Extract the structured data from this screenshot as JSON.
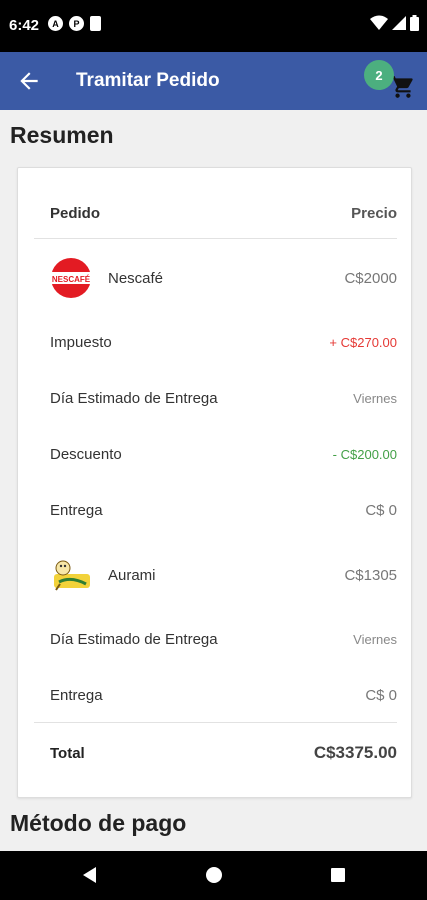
{
  "status_bar": {
    "time": "6:42",
    "icons": [
      "notification-a-icon",
      "notification-p-icon",
      "sd-card-icon",
      "wifi-icon",
      "signal-icon",
      "battery-icon"
    ]
  },
  "app_bar": {
    "title": "Tramitar Pedido",
    "cart_count": "2",
    "color": "#3b5aa5",
    "badge_color": "#4caf7f"
  },
  "summary": {
    "title": "Resumen",
    "header": {
      "order_label": "Pedido",
      "price_label": "Precio"
    },
    "products": [
      {
        "name": "Nescafé",
        "logo_text": "NESCAFÉ",
        "price": "C$2000",
        "details": [
          {
            "label": "Impuesto",
            "value": "+ C$270.00",
            "tone": "red"
          },
          {
            "label": "Día Estimado de Entrega",
            "value": "Viernes",
            "tone": "small"
          },
          {
            "label": "Descuento",
            "value": "- C$200.00",
            "tone": "green"
          },
          {
            "label": "Entrega",
            "value": "C$ 0",
            "tone": "normal"
          }
        ]
      },
      {
        "name": "Aurami",
        "price": "C$1305",
        "details": [
          {
            "label": "Día Estimado de Entrega",
            "value": "Viernes",
            "tone": "small"
          },
          {
            "label": "Entrega",
            "value": "C$ 0",
            "tone": "normal"
          }
        ]
      }
    ],
    "total_label": "Total",
    "total_value": "C$3375.00"
  },
  "payment": {
    "title": "Método de pago"
  },
  "nav_bar": {
    "icons": [
      "back-triangle-icon",
      "home-circle-icon",
      "recents-square-icon"
    ]
  }
}
